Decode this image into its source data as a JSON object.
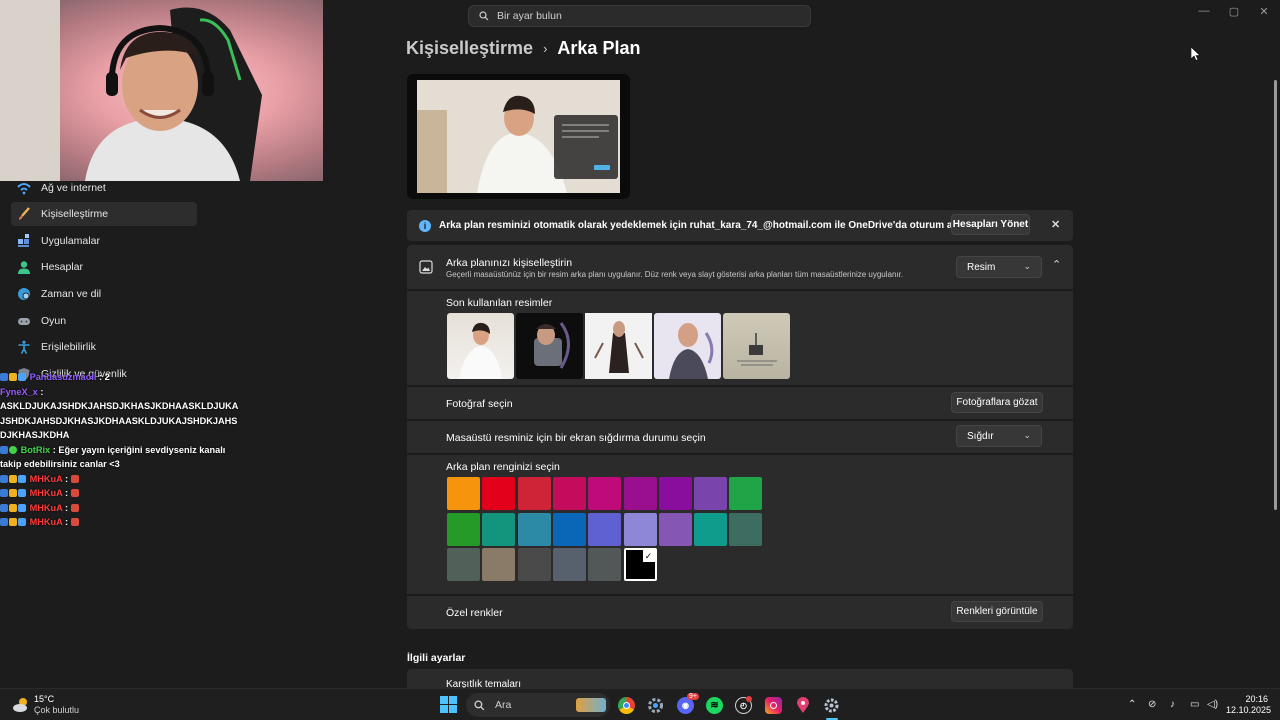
{
  "search": {
    "placeholder": "Bir ayar bulun"
  },
  "window_controls": {
    "minimize": "—",
    "maximize": "▢",
    "close": "✕"
  },
  "sidebar": {
    "items": [
      {
        "label": "Ağ ve internet",
        "icon": "wifi-icon"
      },
      {
        "label": "Kişiselleştirme",
        "icon": "brush-icon",
        "active": true
      },
      {
        "label": "Uygulamalar",
        "icon": "apps-icon"
      },
      {
        "label": "Hesaplar",
        "icon": "person-icon"
      },
      {
        "label": "Zaman ve dil",
        "icon": "globe-clock-icon"
      },
      {
        "label": "Oyun",
        "icon": "gamepad-icon"
      },
      {
        "label": "Erişilebilirlik",
        "icon": "accessibility-icon"
      },
      {
        "label": "Gizlilik ve güvenlik",
        "icon": "shield-icon"
      }
    ]
  },
  "chat": {
    "messages": [
      {
        "user": "Pandasuzmaoii",
        "text": "2"
      },
      {
        "user": "FyneX_x",
        "text": "ASKLDJUKAJSHDKJAHSDJKHASJKDHAASKLDJUKAJSHDKJAHSDJKHASJKDHAASKLDJUKAJSHDKJAHSDJKHASJKDHA"
      },
      {
        "user": "BotRix",
        "text": "Eğer yayın içeriğini sevdiyseniz kanalı takip edebilirsiniz canlar <3"
      },
      {
        "user": "MHKuA",
        "text": ""
      },
      {
        "user": "MHKuA",
        "text": ""
      },
      {
        "user": "MHKuA",
        "text": ""
      },
      {
        "user": "MHKuA",
        "text": ""
      }
    ]
  },
  "breadcrumb": {
    "parent": "Kişiselleştirme",
    "separator": "›",
    "current": "Arka Plan"
  },
  "info_bar": {
    "text": "Arka plan resminizi otomatik olarak yedeklemek için ruhat_kara_74_@hotmail.com ile OneDrive'da oturum açın.",
    "button": "Hesapları Yönet",
    "close": "✕"
  },
  "background": {
    "title": "Arka planınızı kişiselleştirin",
    "subtitle": "Geçerli masaüstünüz için bir resim arka planı uygulanır. Düz renk veya slayt gösterisi arka planları tüm masaüstlerinize uygulanır.",
    "type_value": "Resim",
    "recent_label": "Son kullanılan resimler",
    "choose_photo_label": "Fotoğraf seçin",
    "browse_button": "Fotoğraflara gözat",
    "fit_label": "Masaüstü resminiz için bir ekran sığdırma durumu seçin",
    "fit_value": "Sığdır",
    "color_label": "Arka plan renginizi seçin",
    "custom_colors_label": "Özel renkler",
    "view_colors_button": "Renkleri görüntüle",
    "colors": [
      "#f7940e",
      "#e3001b",
      "#cf2338",
      "#c30d5c",
      "#bf0a7a",
      "#9a0f8e",
      "#8a0e9e",
      "#7a44ad",
      "#1fa447",
      "#249a28",
      "#12957c",
      "#2d8aa6",
      "#0a67b7",
      "#5f61d3",
      "#8e86d6",
      "#8656b5",
      "#109c8c",
      "#3d6d60",
      "#52605a",
      "#8a7a68",
      "#4a4a4a",
      "#57606d",
      "#525757",
      "#000000"
    ],
    "selected_color": "#000000"
  },
  "related": {
    "title": "İlgili ayarlar",
    "first_item": "Karşıtlık temaları"
  },
  "taskbar": {
    "weather_temp": "15°C",
    "weather_desc": "Çok bulutlu",
    "search_placeholder": "Ara",
    "time": "20:16",
    "date": "12.10.2025",
    "discord_badge": "9+"
  }
}
